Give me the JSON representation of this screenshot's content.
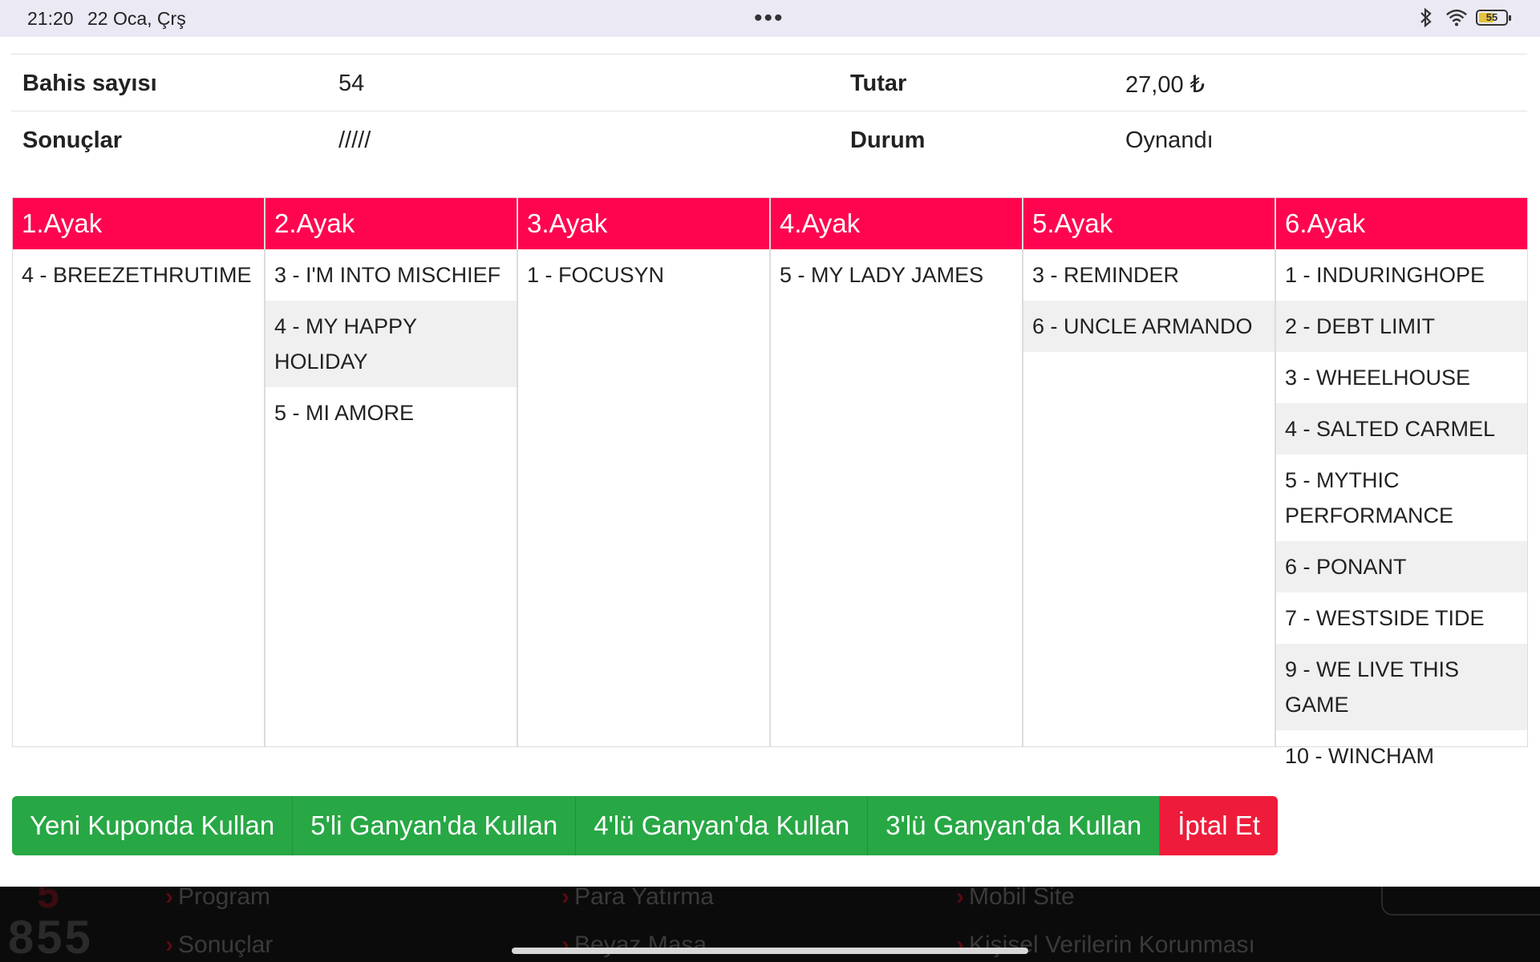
{
  "status_bar": {
    "time": "21:20",
    "date": "22 Oca, Çrş",
    "menu_dots": "•••",
    "battery": "55",
    "battery_level_percent": 55
  },
  "info": {
    "rows": [
      {
        "label1": "Bahis sayısı",
        "value1": "54",
        "label2": "Tutar",
        "value2": "27,00 ₺"
      },
      {
        "label1": "Sonuçlar",
        "value1": "/////",
        "label2": "Durum",
        "value2": "Oynandı"
      }
    ]
  },
  "legs": [
    {
      "title": "1.Ayak",
      "horses": [
        "4 - BREEZETHRUTIME"
      ]
    },
    {
      "title": "2.Ayak",
      "horses": [
        "3 - I'M INTO MISCHIEF",
        "4 - MY HAPPY HOLIDAY",
        "5 - MI AMORE"
      ]
    },
    {
      "title": "3.Ayak",
      "horses": [
        "1 - FOCUSYN"
      ]
    },
    {
      "title": "4.Ayak",
      "horses": [
        "5 - MY LADY JAMES"
      ]
    },
    {
      "title": "5.Ayak",
      "horses": [
        "3 - REMINDER",
        "6 - UNCLE ARMANDO"
      ]
    },
    {
      "title": "6.Ayak",
      "horses": [
        "1 - INDURINGHOPE",
        "2 - DEBT LIMIT",
        "3 - WHEELHOUSE",
        "4 - SALTED CARMEL",
        "5 - MYTHIC PERFORMANCE",
        "6 - PONANT",
        "7 - WESTSIDE TIDE",
        "9 - WE LIVE THIS GAME",
        "10 - WINCHAM"
      ]
    }
  ],
  "buttons": {
    "new_coupon": "Yeni Kuponda Kullan",
    "ganyan5": "5'li Ganyan'da Kullan",
    "ganyan4": "4'lü Ganyan'da Kullan",
    "ganyan3": "3'lü Ganyan'da Kullan",
    "cancel": "İptal Et"
  },
  "footer": {
    "links": [
      "Program",
      "Para Yatırma",
      "Mobil Site",
      "Sonuçlar",
      "Beyaz Masa",
      "Kişisel Verilerin Korunması"
    ]
  },
  "colors": {
    "leg_header": "#ff0550",
    "button_green": "#28a745",
    "button_red": "#ee1c3a"
  }
}
